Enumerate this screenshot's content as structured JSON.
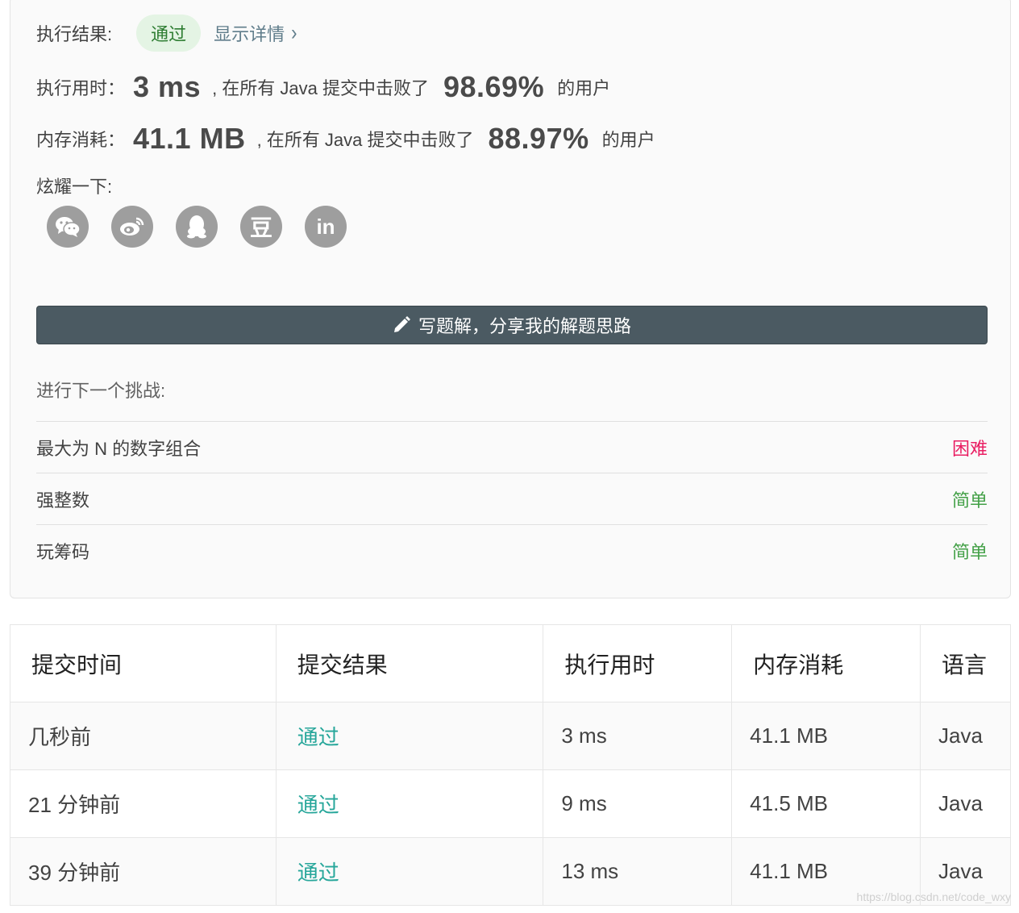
{
  "result": {
    "label": "执行结果:",
    "status": "通过",
    "details_link": "显示详情",
    "chevron": "›"
  },
  "runtime": {
    "label": "执行用时：",
    "value": "3 ms",
    "middle_text": ", 在所有 Java 提交中击败了",
    "percent": "98.69%",
    "suffix": "的用户"
  },
  "memory": {
    "label": "内存消耗：",
    "value": "41.1 MB",
    "middle_text": ", 在所有 Java 提交中击败了",
    "percent": "88.97%",
    "suffix": "的用户"
  },
  "share": {
    "label": "炫耀一下:",
    "icons": [
      "wechat-icon",
      "weibo-icon",
      "qq-icon",
      "douban-icon",
      "linkedin-icon"
    ],
    "douban_glyph": "豆",
    "linkedin_glyph": "in"
  },
  "solution_button": "写题解，分享我的解题思路",
  "next": {
    "title": "进行下一个挑战:",
    "items": [
      {
        "title": "最大为 N 的数字组合",
        "difficulty": "困难"
      },
      {
        "title": "强整数",
        "difficulty": "简单"
      },
      {
        "title": "玩筹码",
        "difficulty": "简单"
      }
    ]
  },
  "submissions": {
    "headers": [
      "提交时间",
      "提交结果",
      "执行用时",
      "内存消耗",
      "语言"
    ],
    "rows": [
      {
        "time": "几秒前",
        "result": "通过",
        "runtime": "3 ms",
        "memory": "41.1 MB",
        "language": "Java"
      },
      {
        "time": "21 分钟前",
        "result": "通过",
        "runtime": "9 ms",
        "memory": "41.5 MB",
        "language": "Java"
      },
      {
        "time": "39 分钟前",
        "result": "通过",
        "runtime": "13 ms",
        "memory": "41.1 MB",
        "language": "Java"
      }
    ]
  },
  "watermark": "https://blog.csdn.net/code_wxy",
  "colors": {
    "pass_green": "#2e7d32",
    "pass_bg": "#e4f4e4",
    "hard": "#e91e63",
    "easy": "#43a047",
    "button_bg": "#4b5a62",
    "link": "#607d8b",
    "status_teal": "#26a69a",
    "icon_gray": "#9e9e9e"
  }
}
